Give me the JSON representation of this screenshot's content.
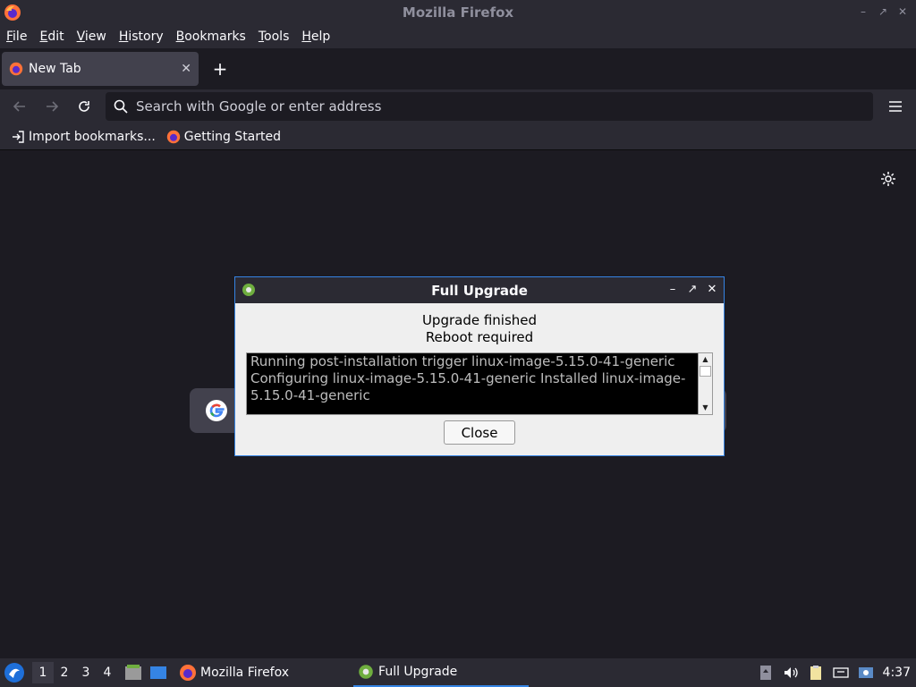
{
  "window": {
    "title": "Mozilla Firefox"
  },
  "menu": [
    "File",
    "Edit",
    "View",
    "History",
    "Bookmarks",
    "Tools",
    "Help"
  ],
  "tab": {
    "title": "New Tab"
  },
  "urlbar": {
    "placeholder": "Search with Google or enter address"
  },
  "bookmarks": [
    {
      "label": "Import bookmarks...",
      "icon": "import-icon"
    },
    {
      "label": "Getting Started",
      "icon": "firefox-icon"
    }
  ],
  "dialog": {
    "title": "Full Upgrade",
    "message_line1": "Upgrade finished",
    "message_line2": "Reboot required",
    "log": "Running post-installation trigger linux-image-5.15.0-41-generic Configuring linux-image-5.15.0-41-generic Installed linux-image-5.15.0-41-generic",
    "close_label": "Close"
  },
  "taskbar": {
    "workspaces": [
      "1",
      "2",
      "3",
      "4"
    ],
    "tasks": [
      {
        "label": "Mozilla Firefox",
        "icon": "firefox-icon"
      },
      {
        "label": "Full Upgrade",
        "icon": "gear-icon"
      }
    ],
    "clock": "4:37"
  },
  "colors": {
    "accent": "#3584e4",
    "background": "#1c1b22",
    "toolbar": "#2b2a33"
  }
}
